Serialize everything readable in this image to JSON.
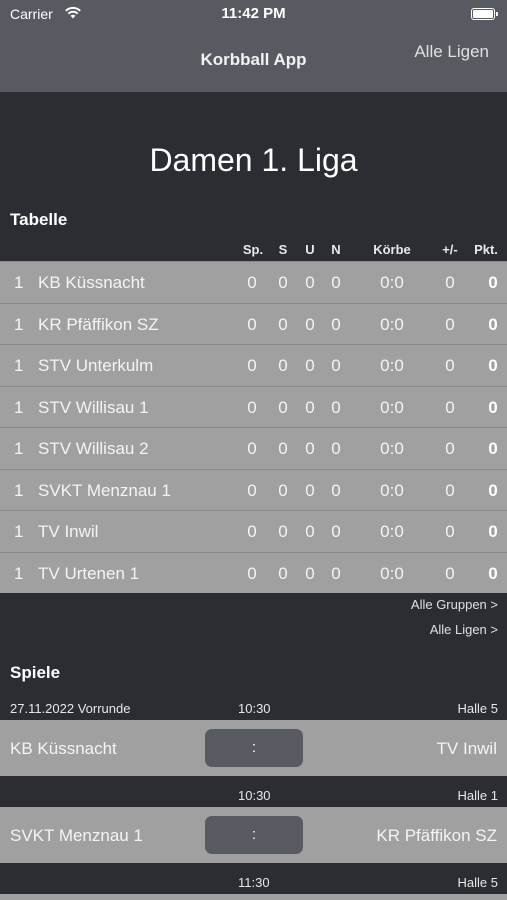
{
  "status": {
    "carrier": "Carrier",
    "time": "11:42 PM"
  },
  "nav": {
    "title": "Korbball App",
    "right_button": "Alle Ligen"
  },
  "league": {
    "title": "Damen 1. Liga"
  },
  "table": {
    "section_title": "Tabelle",
    "headers": {
      "sp": "Sp.",
      "s": "S",
      "u": "U",
      "n": "N",
      "korbe": "Körbe",
      "diff": "+/-",
      "pkt": "Pkt."
    },
    "rows": [
      {
        "rank": "1",
        "team": "KB Küssnacht",
        "sp": "0",
        "s": "0",
        "u": "0",
        "n": "0",
        "korbe": "0:0",
        "diff": "0",
        "pkt": "0"
      },
      {
        "rank": "1",
        "team": "KR Pfäffikon SZ",
        "sp": "0",
        "s": "0",
        "u": "0",
        "n": "0",
        "korbe": "0:0",
        "diff": "0",
        "pkt": "0"
      },
      {
        "rank": "1",
        "team": "STV Unterkulm",
        "sp": "0",
        "s": "0",
        "u": "0",
        "n": "0",
        "korbe": "0:0",
        "diff": "0",
        "pkt": "0"
      },
      {
        "rank": "1",
        "team": "STV Willisau 1",
        "sp": "0",
        "s": "0",
        "u": "0",
        "n": "0",
        "korbe": "0:0",
        "diff": "0",
        "pkt": "0"
      },
      {
        "rank": "1",
        "team": "STV Willisau 2",
        "sp": "0",
        "s": "0",
        "u": "0",
        "n": "0",
        "korbe": "0:0",
        "diff": "0",
        "pkt": "0"
      },
      {
        "rank": "1",
        "team": "SVKT Menznau 1",
        "sp": "0",
        "s": "0",
        "u": "0",
        "n": "0",
        "korbe": "0:0",
        "diff": "0",
        "pkt": "0"
      },
      {
        "rank": "1",
        "team": "TV Inwil",
        "sp": "0",
        "s": "0",
        "u": "0",
        "n": "0",
        "korbe": "0:0",
        "diff": "0",
        "pkt": "0"
      },
      {
        "rank": "1",
        "team": "TV Urtenen 1",
        "sp": "0",
        "s": "0",
        "u": "0",
        "n": "0",
        "korbe": "0:0",
        "diff": "0",
        "pkt": "0"
      }
    ],
    "link_groups": "Alle Gruppen >",
    "link_leagues": "Alle Ligen >"
  },
  "games": {
    "section_title": "Spiele",
    "items": [
      {
        "date": "27.11.2022 Vorrunde",
        "time": "10:30",
        "hall": "Halle 5",
        "home": "KB Küssnacht",
        "away": "TV Inwil",
        "score": ":"
      },
      {
        "date": "",
        "time": "10:30",
        "hall": "Halle 1",
        "home": "SVKT Menznau 1",
        "away": "KR Pfäffikon SZ",
        "score": ":"
      },
      {
        "date": "",
        "time": "11:30",
        "hall": "Halle 5",
        "home": "",
        "away": "",
        "score": ""
      }
    ]
  }
}
